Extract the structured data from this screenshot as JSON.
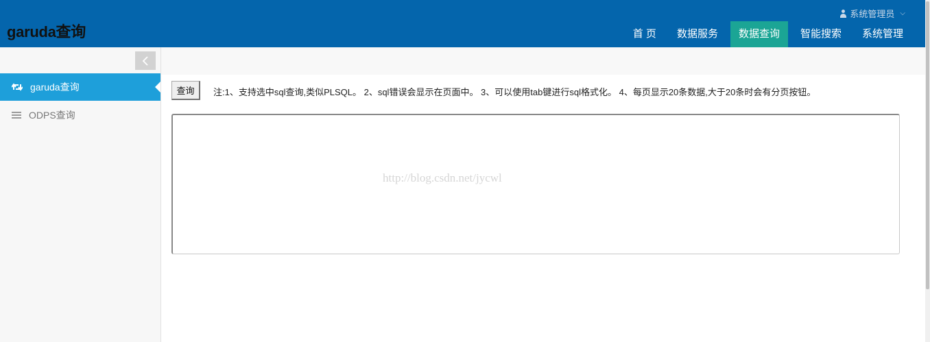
{
  "header": {
    "brand": "garuda查询",
    "user": "系统管理员",
    "nav": [
      {
        "label": "首 页"
      },
      {
        "label": "数据服务"
      },
      {
        "label": "数据查询"
      },
      {
        "label": "智能搜索"
      },
      {
        "label": "系统管理"
      }
    ],
    "active_nav": "数据查询"
  },
  "sidebar": {
    "items": [
      {
        "label": "garuda查询",
        "icon": "retweet-icon",
        "active": true
      },
      {
        "label": "ODPS查询",
        "icon": "list-icon",
        "active": false
      }
    ]
  },
  "main": {
    "query_button": "查询",
    "note": "注:1、支持选中sql查询,类似PLSQL。   2、sql错误会显示在页面中。   3、可以使用tab键进行sql格式化。   4、每页显示20条数据,大于20条时会有分页按钮。",
    "editor_value": "",
    "watermark": "http://blog.csdn.net/jycwl"
  },
  "colors": {
    "header_bg": "#0465ac",
    "active_nav": "#1ba595",
    "active_side": "#1e9fda"
  }
}
